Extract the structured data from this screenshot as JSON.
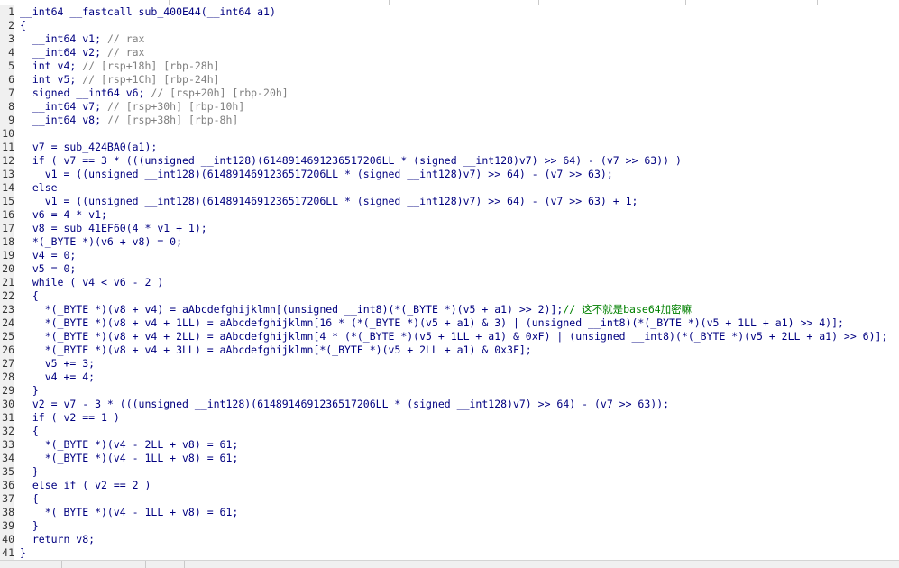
{
  "lines": [
    {
      "n": "1",
      "t": "__int64 __fastcall sub_400E44(__int64 a1)"
    },
    {
      "n": "2",
      "t": "{"
    },
    {
      "n": "3",
      "t": "  __int64 v1; // rax"
    },
    {
      "n": "4",
      "t": "  __int64 v2; // rax"
    },
    {
      "n": "5",
      "t": "  int v4; // [rsp+18h] [rbp-28h]"
    },
    {
      "n": "6",
      "t": "  int v5; // [rsp+1Ch] [rbp-24h]"
    },
    {
      "n": "7",
      "t": "  signed __int64 v6; // [rsp+20h] [rbp-20h]"
    },
    {
      "n": "8",
      "t": "  __int64 v7; // [rsp+30h] [rbp-10h]"
    },
    {
      "n": "9",
      "t": "  __int64 v8; // [rsp+38h] [rbp-8h]"
    },
    {
      "n": "10",
      "t": ""
    },
    {
      "n": "11",
      "t": "  v7 = sub_424BA0(a1);"
    },
    {
      "n": "12",
      "t": "  if ( v7 == 3 * (((unsigned __int128)(6148914691236517206LL * (signed __int128)v7) >> 64) - (v7 >> 63)) )"
    },
    {
      "n": "13",
      "t": "    v1 = ((unsigned __int128)(6148914691236517206LL * (signed __int128)v7) >> 64) - (v7 >> 63);"
    },
    {
      "n": "14",
      "t": "  else"
    },
    {
      "n": "15",
      "t": "    v1 = ((unsigned __int128)(6148914691236517206LL * (signed __int128)v7) >> 64) - (v7 >> 63) + 1;"
    },
    {
      "n": "16",
      "t": "  v6 = 4 * v1;"
    },
    {
      "n": "17",
      "t": "  v8 = sub_41EF60(4 * v1 + 1);"
    },
    {
      "n": "18",
      "t": "  *(_BYTE *)(v6 + v8) = 0;"
    },
    {
      "n": "19",
      "t": "  v4 = 0;"
    },
    {
      "n": "20",
      "t": "  v5 = 0;"
    },
    {
      "n": "21",
      "t": "  while ( v4 < v6 - 2 )"
    },
    {
      "n": "22",
      "t": "  {"
    },
    {
      "n": "23",
      "t": "    *(_BYTE *)(v8 + v4) = aAbcdefghijklmn[(unsigned __int8)(*(_BYTE *)(v5 + a1) >> 2)];",
      "c": "// 这不就是base64加密嘛"
    },
    {
      "n": "24",
      "t": "    *(_BYTE *)(v8 + v4 + 1LL) = aAbcdefghijklmn[16 * (*(_BYTE *)(v5 + a1) & 3) | (unsigned __int8)(*(_BYTE *)(v5 + 1LL + a1) >> 4)];"
    },
    {
      "n": "25",
      "t": "    *(_BYTE *)(v8 + v4 + 2LL) = aAbcdefghijklmn[4 * (*(_BYTE *)(v5 + 1LL + a1) & 0xF) | (unsigned __int8)(*(_BYTE *)(v5 + 2LL + a1) >> 6)];"
    },
    {
      "n": "26",
      "t": "    *(_BYTE *)(v8 + v4 + 3LL) = aAbcdefghijklmn[*(_BYTE *)(v5 + 2LL + a1) & 0x3F];"
    },
    {
      "n": "27",
      "t": "    v5 += 3;"
    },
    {
      "n": "28",
      "t": "    v4 += 4;"
    },
    {
      "n": "29",
      "t": "  }"
    },
    {
      "n": "30",
      "t": "  v2 = v7 - 3 * (((unsigned __int128)(6148914691236517206LL * (signed __int128)v7) >> 64) - (v7 >> 63));"
    },
    {
      "n": "31",
      "t": "  if ( v2 == 1 )"
    },
    {
      "n": "32",
      "t": "  {"
    },
    {
      "n": "33",
      "t": "    *(_BYTE *)(v4 - 2LL + v8) = 61;"
    },
    {
      "n": "34",
      "t": "    *(_BYTE *)(v4 - 1LL + v8) = 61;"
    },
    {
      "n": "35",
      "t": "  }"
    },
    {
      "n": "36",
      "t": "  else if ( v2 == 2 )"
    },
    {
      "n": "37",
      "t": "  {"
    },
    {
      "n": "38",
      "t": "    *(_BYTE *)(v4 - 1LL + v8) = 61;"
    },
    {
      "n": "39",
      "t": "  }"
    },
    {
      "n": "40",
      "t": "  return v8;"
    },
    {
      "n": "41",
      "t": "}"
    }
  ],
  "colors": {
    "code": "#000080",
    "comment": "#808080",
    "user_comment": "#008000",
    "gutter_bg": "#f0f0f0"
  }
}
